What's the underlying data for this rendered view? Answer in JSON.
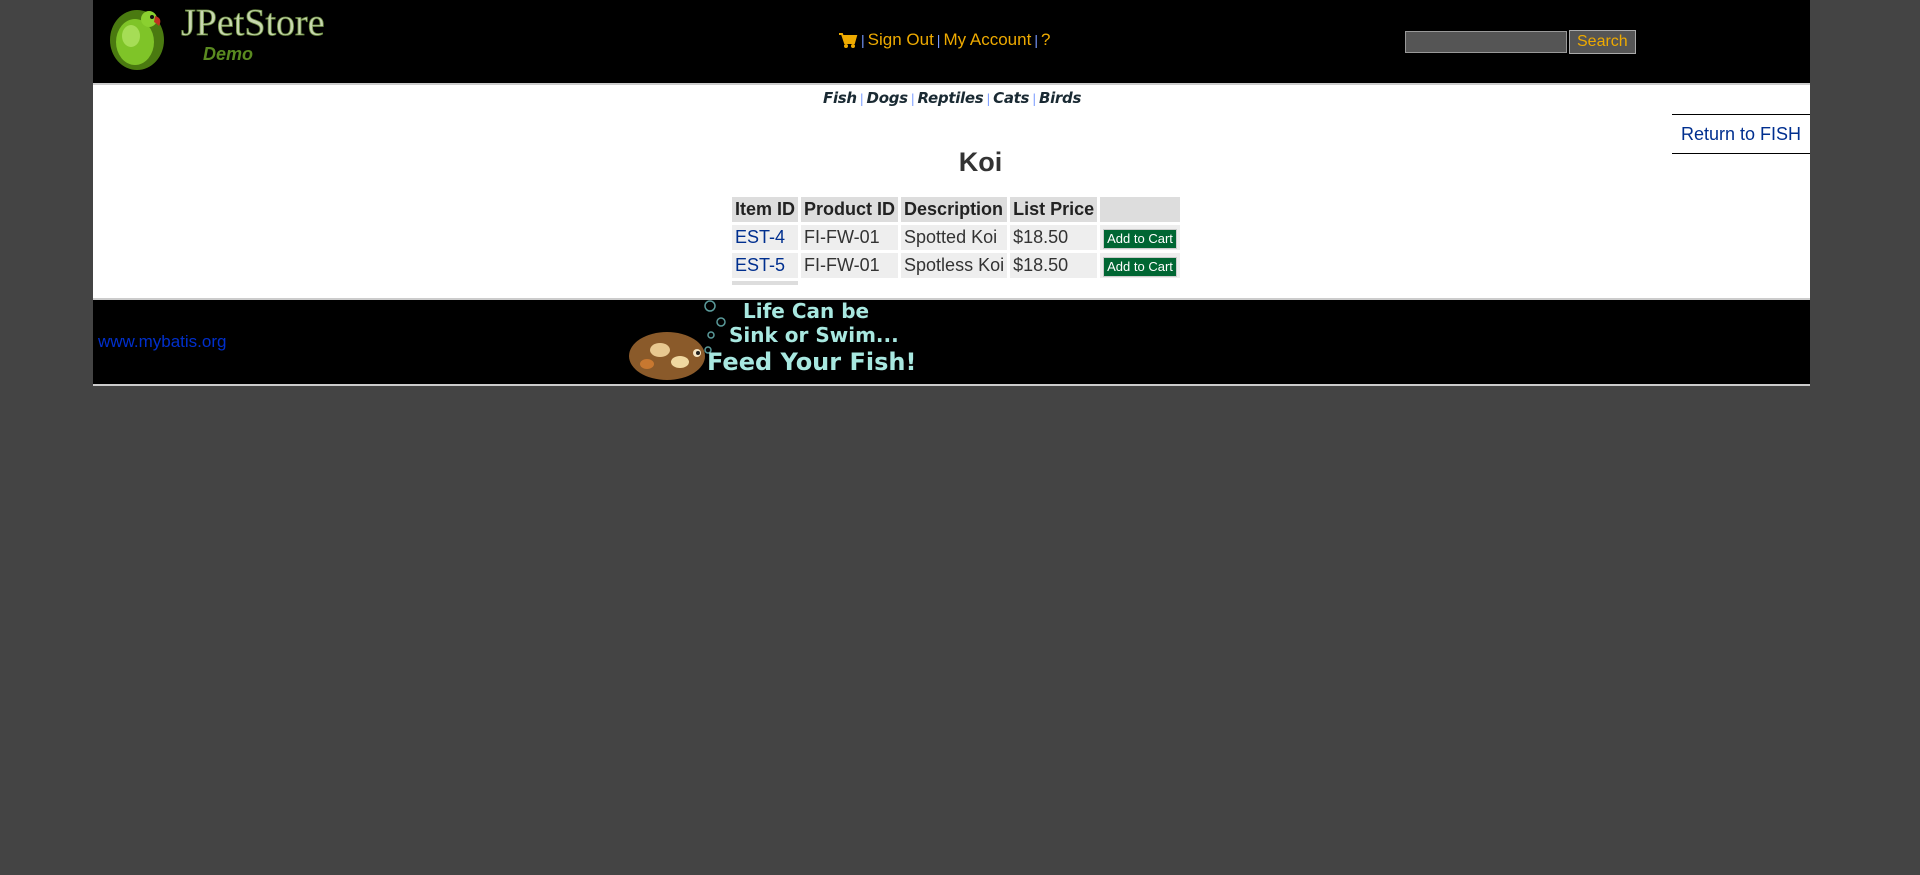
{
  "header": {
    "logo_title": "JPetStore",
    "logo_subtitle": "Demo",
    "menu": {
      "sign_out": "Sign Out",
      "my_account": "My Account",
      "help": "?",
      "separator": "|"
    },
    "search": {
      "value": "",
      "button_label": "Search"
    }
  },
  "quicklinks": [
    "Fish",
    "Dogs",
    "Reptiles",
    "Cats",
    "Birds"
  ],
  "back_link": "Return to FISH",
  "product": {
    "name": "Koi"
  },
  "table": {
    "headers": [
      "Item ID",
      "Product ID",
      "Description",
      "List Price",
      ""
    ],
    "rows": [
      {
        "item_id": "EST-4",
        "product_id": "FI-FW-01",
        "description": "Spotted Koi",
        "price": "$18.50",
        "action": "Add to Cart"
      },
      {
        "item_id": "EST-5",
        "product_id": "FI-FW-01",
        "description": "Spotless Koi",
        "price": "$18.50",
        "action": "Add to Cart"
      }
    ]
  },
  "footer": {
    "link": "www.mybatis.org",
    "banner_lines": [
      "Life Can be",
      "Sink or Swim...",
      "Feed Your Fish!"
    ]
  },
  "colors": {
    "menu_link": "#eeaa00",
    "add_to_cart_bg": "#006633",
    "link_blue": "#002f8f"
  }
}
